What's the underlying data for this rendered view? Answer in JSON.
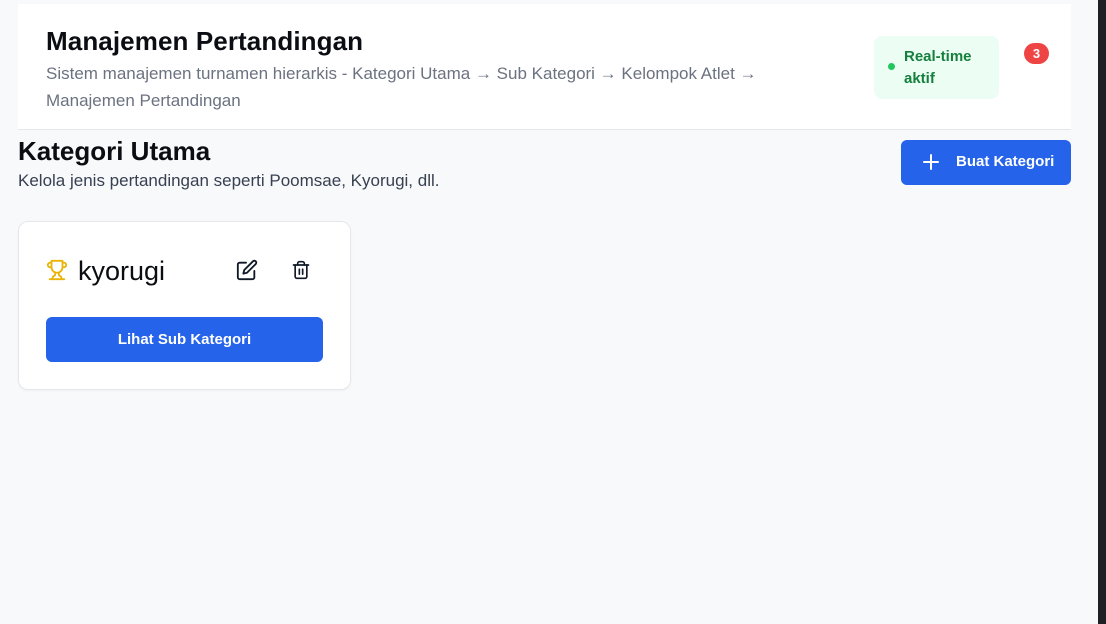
{
  "header": {
    "title": "Manajemen Pertandingan",
    "subtitle": "Sistem manajemen turnamen hierarkis - Kategori Utama → Sub Kategori → Kelompok Atlet → Manajemen Pertandingan",
    "realtime_label": "Real-time aktif",
    "notification_count": "3"
  },
  "section": {
    "title": "Kategori Utama",
    "subtitle": "Kelola jenis pertandingan seperti Poomsae, Kyorugi, dll.",
    "create_button": "Buat Kategori"
  },
  "categories": [
    {
      "name": "kyorugi",
      "icon": "trophy-icon",
      "view_button": "Lihat Sub Kategori"
    }
  ],
  "colors": {
    "primary": "#2563eb",
    "success_bg": "#ecfdf3",
    "success_text": "#15803d",
    "danger": "#ef4444",
    "trophy": "#eab308"
  }
}
